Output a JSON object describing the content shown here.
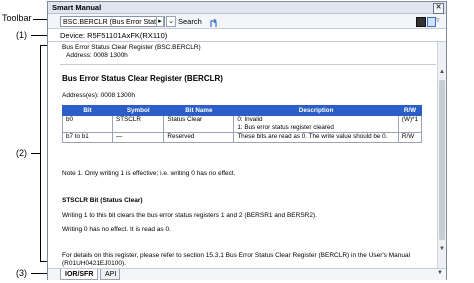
{
  "callouts": {
    "toolbar": "Toolbar",
    "c1": "(1)",
    "c2": "(2)",
    "c3": "(3)"
  },
  "window": {
    "title": "Smart Manual",
    "close_glyph": "✕"
  },
  "toolbar": {
    "combo_value": "BSC.BERCLR (Bus Error Statu",
    "search_label": "Search"
  },
  "device": "Device: R5F51101AxFK(RX110)",
  "content": {
    "head_line1": "Bus Error Status Clear Register (BSC.BERCLR)",
    "head_line2": "Address: 0008 1300h",
    "heading": "Bus Error Status Clear Register (BERCLR)",
    "address": "Address(es): 0008 1300h",
    "table": {
      "headers": [
        "Bit",
        "Symbol",
        "Bit Name",
        "Description",
        "R/W"
      ],
      "rows": [
        [
          "b0",
          "STSCLR",
          "Status Clear",
          "0: Invalid\n1: Bus error status register cleared",
          "(W)*1"
        ],
        [
          "b7 to b1",
          "—",
          "Reserved",
          "These bits are read as 0. The write value should be 0.",
          "R/W"
        ]
      ]
    },
    "note": "Note 1. Only writing 1 is effective; i.e. writing 0 has no effect.",
    "bit_heading": "STSCLR Bit (Status Clear)",
    "bit_desc1": "Writing 1 to this bit clears the bus error status registers 1 and 2 (BERSR1 and BERSR2).",
    "bit_desc2": "Writing 0 has no effect. It is read as 0.",
    "details_line1": "For details on this register, please refer to section 15.3.1 Bus Error Status Clear Register (BERCLR) in the User's Manual",
    "details_line2": "(R01UH0421EJ0100)."
  },
  "tabs": [
    {
      "label": "IOR/SFR",
      "active": true
    },
    {
      "label": "API",
      "active": false
    }
  ],
  "icons": [
    "dropdown-arrow-icon",
    "forward-icon",
    "sync-icon",
    "panel-icon",
    "book-icon",
    "menu-chevron-icon",
    "scroll-up-icon",
    "scroll-down-icon"
  ]
}
